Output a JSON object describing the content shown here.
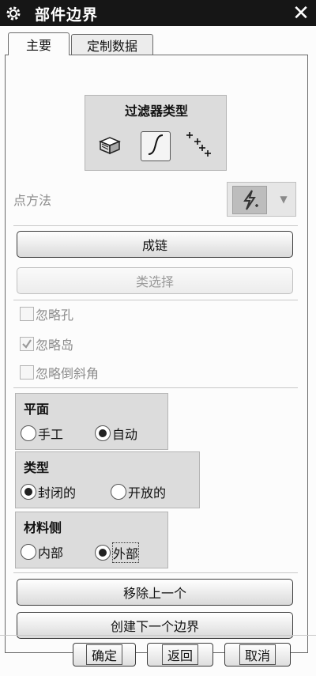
{
  "window": {
    "title": "部件边界",
    "icon": "gear-icon",
    "close_icon": "close-icon"
  },
  "tabs": [
    {
      "label": "主要",
      "active": true
    },
    {
      "label": "定制数据",
      "active": false
    }
  ],
  "filter": {
    "title": "过滤器类型",
    "options": [
      {
        "icon": "face-icon",
        "selected": false
      },
      {
        "icon": "curve-icon",
        "selected": true
      },
      {
        "icon": "points-icon",
        "selected": false
      }
    ]
  },
  "point_method": {
    "label": "点方法",
    "enabled": false,
    "icon": "lightning-point-icon"
  },
  "chain_button": "成链",
  "class_select_button": "类选择",
  "checkboxes": [
    {
      "label": "忽略孔",
      "checked": false,
      "enabled": false
    },
    {
      "label": "忽略岛",
      "checked": true,
      "enabled": false
    },
    {
      "label": "忽略倒斜角",
      "checked": false,
      "enabled": false
    }
  ],
  "plane": {
    "title": "平面",
    "options": [
      "手工",
      "自动"
    ],
    "selected": "自动"
  },
  "type": {
    "title": "类型",
    "options": [
      "封闭的",
      "开放的"
    ],
    "selected": "封闭的"
  },
  "material_side": {
    "title": "材料侧",
    "options": [
      "内部",
      "外部"
    ],
    "selected": "外部"
  },
  "remove_last_button": "移除上一个",
  "create_next_button": "创建下一个边界",
  "footer": {
    "ok": "确定",
    "back": "返回",
    "cancel": "取消"
  },
  "colors": {
    "title_bar": "#161616",
    "group_bg": "#dcdcdc",
    "disabled_text": "#8c8c8c"
  }
}
